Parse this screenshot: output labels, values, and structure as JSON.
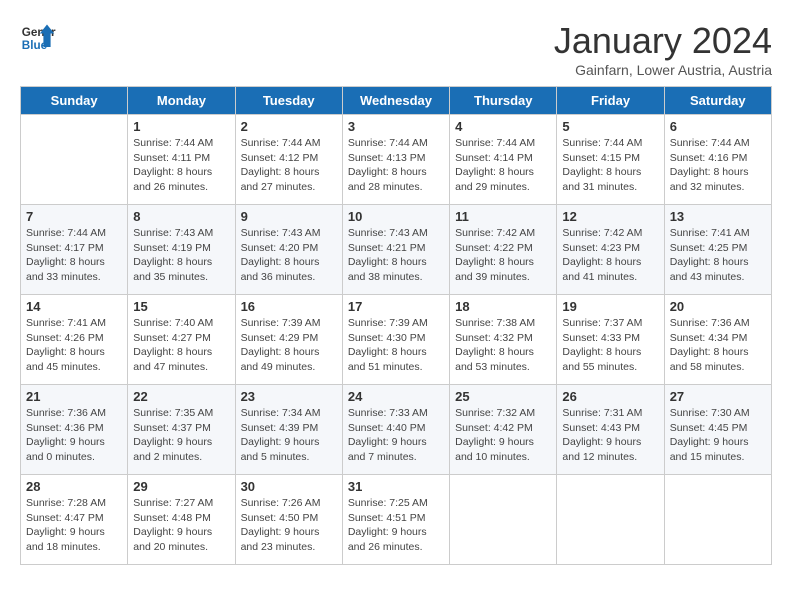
{
  "logo": {
    "line1": "General",
    "line2": "Blue"
  },
  "title": "January 2024",
  "location": "Gainfarn, Lower Austria, Austria",
  "headers": [
    "Sunday",
    "Monday",
    "Tuesday",
    "Wednesday",
    "Thursday",
    "Friday",
    "Saturday"
  ],
  "weeks": [
    [
      {
        "day": "",
        "sunrise": "",
        "sunset": "",
        "daylight": ""
      },
      {
        "day": "1",
        "sunrise": "Sunrise: 7:44 AM",
        "sunset": "Sunset: 4:11 PM",
        "daylight": "Daylight: 8 hours and 26 minutes."
      },
      {
        "day": "2",
        "sunrise": "Sunrise: 7:44 AM",
        "sunset": "Sunset: 4:12 PM",
        "daylight": "Daylight: 8 hours and 27 minutes."
      },
      {
        "day": "3",
        "sunrise": "Sunrise: 7:44 AM",
        "sunset": "Sunset: 4:13 PM",
        "daylight": "Daylight: 8 hours and 28 minutes."
      },
      {
        "day": "4",
        "sunrise": "Sunrise: 7:44 AM",
        "sunset": "Sunset: 4:14 PM",
        "daylight": "Daylight: 8 hours and 29 minutes."
      },
      {
        "day": "5",
        "sunrise": "Sunrise: 7:44 AM",
        "sunset": "Sunset: 4:15 PM",
        "daylight": "Daylight: 8 hours and 31 minutes."
      },
      {
        "day": "6",
        "sunrise": "Sunrise: 7:44 AM",
        "sunset": "Sunset: 4:16 PM",
        "daylight": "Daylight: 8 hours and 32 minutes."
      }
    ],
    [
      {
        "day": "7",
        "sunrise": "Sunrise: 7:44 AM",
        "sunset": "Sunset: 4:17 PM",
        "daylight": "Daylight: 8 hours and 33 minutes."
      },
      {
        "day": "8",
        "sunrise": "Sunrise: 7:43 AM",
        "sunset": "Sunset: 4:19 PM",
        "daylight": "Daylight: 8 hours and 35 minutes."
      },
      {
        "day": "9",
        "sunrise": "Sunrise: 7:43 AM",
        "sunset": "Sunset: 4:20 PM",
        "daylight": "Daylight: 8 hours and 36 minutes."
      },
      {
        "day": "10",
        "sunrise": "Sunrise: 7:43 AM",
        "sunset": "Sunset: 4:21 PM",
        "daylight": "Daylight: 8 hours and 38 minutes."
      },
      {
        "day": "11",
        "sunrise": "Sunrise: 7:42 AM",
        "sunset": "Sunset: 4:22 PM",
        "daylight": "Daylight: 8 hours and 39 minutes."
      },
      {
        "day": "12",
        "sunrise": "Sunrise: 7:42 AM",
        "sunset": "Sunset: 4:23 PM",
        "daylight": "Daylight: 8 hours and 41 minutes."
      },
      {
        "day": "13",
        "sunrise": "Sunrise: 7:41 AM",
        "sunset": "Sunset: 4:25 PM",
        "daylight": "Daylight: 8 hours and 43 minutes."
      }
    ],
    [
      {
        "day": "14",
        "sunrise": "Sunrise: 7:41 AM",
        "sunset": "Sunset: 4:26 PM",
        "daylight": "Daylight: 8 hours and 45 minutes."
      },
      {
        "day": "15",
        "sunrise": "Sunrise: 7:40 AM",
        "sunset": "Sunset: 4:27 PM",
        "daylight": "Daylight: 8 hours and 47 minutes."
      },
      {
        "day": "16",
        "sunrise": "Sunrise: 7:39 AM",
        "sunset": "Sunset: 4:29 PM",
        "daylight": "Daylight: 8 hours and 49 minutes."
      },
      {
        "day": "17",
        "sunrise": "Sunrise: 7:39 AM",
        "sunset": "Sunset: 4:30 PM",
        "daylight": "Daylight: 8 hours and 51 minutes."
      },
      {
        "day": "18",
        "sunrise": "Sunrise: 7:38 AM",
        "sunset": "Sunset: 4:32 PM",
        "daylight": "Daylight: 8 hours and 53 minutes."
      },
      {
        "day": "19",
        "sunrise": "Sunrise: 7:37 AM",
        "sunset": "Sunset: 4:33 PM",
        "daylight": "Daylight: 8 hours and 55 minutes."
      },
      {
        "day": "20",
        "sunrise": "Sunrise: 7:36 AM",
        "sunset": "Sunset: 4:34 PM",
        "daylight": "Daylight: 8 hours and 58 minutes."
      }
    ],
    [
      {
        "day": "21",
        "sunrise": "Sunrise: 7:36 AM",
        "sunset": "Sunset: 4:36 PM",
        "daylight": "Daylight: 9 hours and 0 minutes."
      },
      {
        "day": "22",
        "sunrise": "Sunrise: 7:35 AM",
        "sunset": "Sunset: 4:37 PM",
        "daylight": "Daylight: 9 hours and 2 minutes."
      },
      {
        "day": "23",
        "sunrise": "Sunrise: 7:34 AM",
        "sunset": "Sunset: 4:39 PM",
        "daylight": "Daylight: 9 hours and 5 minutes."
      },
      {
        "day": "24",
        "sunrise": "Sunrise: 7:33 AM",
        "sunset": "Sunset: 4:40 PM",
        "daylight": "Daylight: 9 hours and 7 minutes."
      },
      {
        "day": "25",
        "sunrise": "Sunrise: 7:32 AM",
        "sunset": "Sunset: 4:42 PM",
        "daylight": "Daylight: 9 hours and 10 minutes."
      },
      {
        "day": "26",
        "sunrise": "Sunrise: 7:31 AM",
        "sunset": "Sunset: 4:43 PM",
        "daylight": "Daylight: 9 hours and 12 minutes."
      },
      {
        "day": "27",
        "sunrise": "Sunrise: 7:30 AM",
        "sunset": "Sunset: 4:45 PM",
        "daylight": "Daylight: 9 hours and 15 minutes."
      }
    ],
    [
      {
        "day": "28",
        "sunrise": "Sunrise: 7:28 AM",
        "sunset": "Sunset: 4:47 PM",
        "daylight": "Daylight: 9 hours and 18 minutes."
      },
      {
        "day": "29",
        "sunrise": "Sunrise: 7:27 AM",
        "sunset": "Sunset: 4:48 PM",
        "daylight": "Daylight: 9 hours and 20 minutes."
      },
      {
        "day": "30",
        "sunrise": "Sunrise: 7:26 AM",
        "sunset": "Sunset: 4:50 PM",
        "daylight": "Daylight: 9 hours and 23 minutes."
      },
      {
        "day": "31",
        "sunrise": "Sunrise: 7:25 AM",
        "sunset": "Sunset: 4:51 PM",
        "daylight": "Daylight: 9 hours and 26 minutes."
      },
      {
        "day": "",
        "sunrise": "",
        "sunset": "",
        "daylight": ""
      },
      {
        "day": "",
        "sunrise": "",
        "sunset": "",
        "daylight": ""
      },
      {
        "day": "",
        "sunrise": "",
        "sunset": "",
        "daylight": ""
      }
    ]
  ]
}
